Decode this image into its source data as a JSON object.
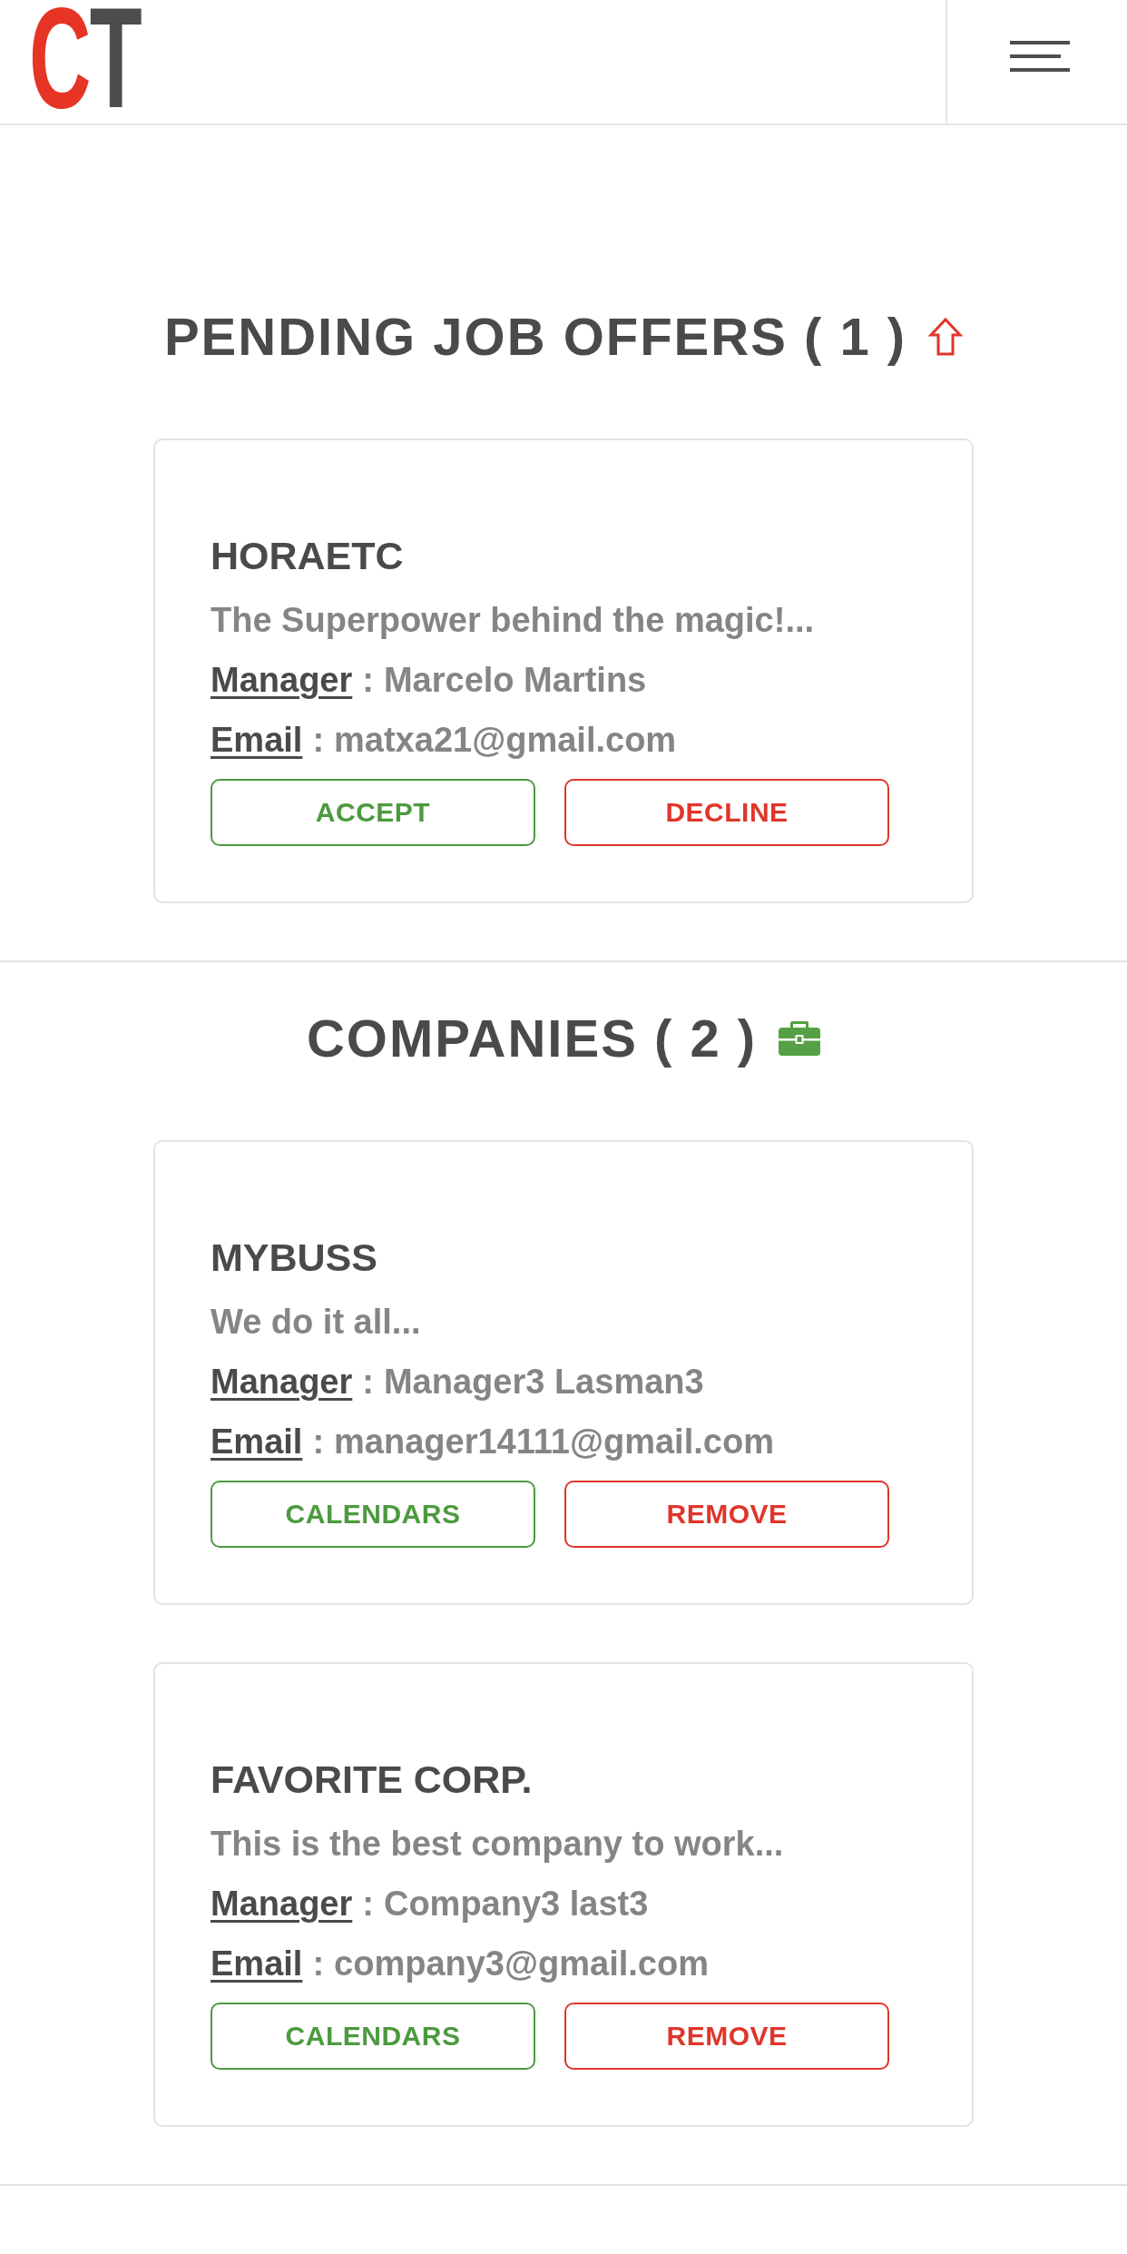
{
  "header": {
    "logo": [
      {
        "text": "C",
        "color": "#e63425"
      },
      {
        "text": "T",
        "color": "#4d4d4d"
      }
    ]
  },
  "sections": [
    {
      "kind": "pending_offers",
      "title": "PENDING JOB OFFERS ( 1 )",
      "items": [
        {
          "name": "HORAETC",
          "description": "The Superpower behind the magic!...",
          "fields": [
            {
              "label": "Manager",
              "separator": ":",
              "value": "Marcelo Martins"
            },
            {
              "label": "Email",
              "separator": ":",
              "value": "matxa21@gmail.com"
            }
          ],
          "actions": [
            {
              "label": "ACCEPT",
              "kind": "accept"
            },
            {
              "label": "DECLINE",
              "kind": "decline"
            }
          ]
        }
      ]
    },
    {
      "kind": "companies",
      "title": "COMPANIES ( 2 )",
      "items": [
        {
          "name": "MYBUSS",
          "description": "We do it all...",
          "fields": [
            {
              "label": "Manager",
              "separator": ":",
              "value": "Manager3 Lasman3"
            },
            {
              "label": "Email",
              "separator": ":",
              "value": "manager14111@gmail.com"
            }
          ],
          "actions": [
            {
              "label": "CALENDARS",
              "kind": "calendars"
            },
            {
              "label": "REMOVE",
              "kind": "remove"
            }
          ]
        },
        {
          "name": "FAVORITE CORP.",
          "description": "This is the best company to work...",
          "fields": [
            {
              "label": "Manager",
              "separator": ":",
              "value": "Company3 last3"
            },
            {
              "label": "Email",
              "separator": ":",
              "value": "company3@gmail.com"
            }
          ],
          "actions": [
            {
              "label": "CALENDARS",
              "kind": "calendars"
            },
            {
              "label": "REMOVE",
              "kind": "remove"
            }
          ]
        }
      ]
    }
  ]
}
